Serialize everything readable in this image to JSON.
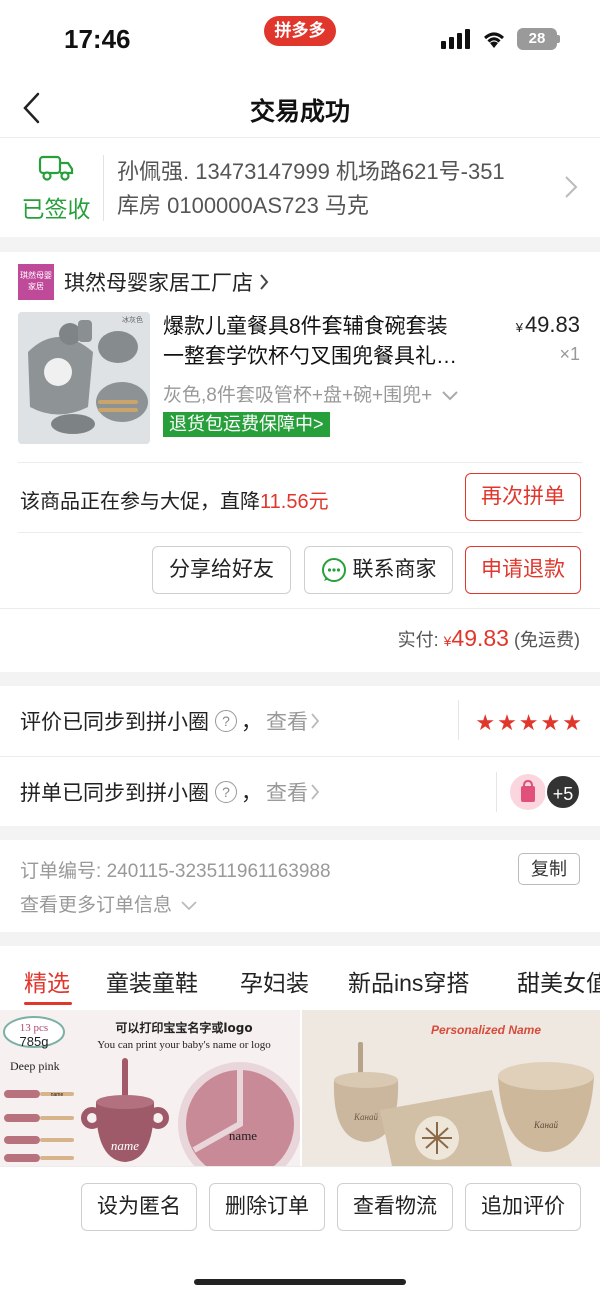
{
  "status_bar": {
    "time": "17:46",
    "app_pill": "拼多多",
    "battery": "28"
  },
  "navbar": {
    "title": "交易成功"
  },
  "address": {
    "status": "已签收",
    "line1": "孙佩强. 13473147999 机场路621号-351",
    "line2": "库房 0100000AS723 马克"
  },
  "store": {
    "logo_text": "琪然母婴家居",
    "name": "琪然母婴家居工厂店"
  },
  "product": {
    "title_line1": "爆款儿童餐具8件套辅食碗套装",
    "title_line2": "一整套学饮杯勺叉围兜餐具礼…",
    "image_tag": "冰灰色",
    "price_symbol": "¥",
    "price": "49.83",
    "quantity": "×1",
    "spec": "灰色,8件套吸管杯+盘+碗+围兜+",
    "badge": "退货包运费保障中>"
  },
  "promo": {
    "text": "该商品正在参与大促，直降",
    "amount": "11.56元",
    "button": "再次拼单"
  },
  "actions": {
    "share": "分享给好友",
    "contact": "联系商家",
    "refund": "申请退款"
  },
  "payment": {
    "label": "实付:",
    "symbol": "¥",
    "amount": "49.83",
    "note": "(免运费)"
  },
  "sync": {
    "review_text": "评价已同步到拼小圈",
    "group_text": "拼单已同步到拼小圈",
    "qmark": "?",
    "comma": "，",
    "view": "查看",
    "stars": [
      "★",
      "★",
      "★",
      "★",
      "★"
    ],
    "plus_count": "+5"
  },
  "order_info": {
    "number_label": "订单编号:",
    "number": "240115-323511961163988",
    "copy": "复制",
    "more": "查看更多订单信息"
  },
  "tabs": [
    "精选",
    "童装童鞋",
    "孕妇装",
    "新品ins穿搭",
    "甜美女值"
  ],
  "recommend": {
    "left": {
      "pcs": "13 pcs",
      "weight": "785g",
      "color_name": "Deep pink",
      "line1": "可以打印宝宝名字或logo",
      "line2": "You can print your baby's name or logo",
      "cup_label": "name",
      "plate_label": "name",
      "spoon_label": "name"
    },
    "right": {
      "headline": "Personalized Name",
      "cup_label": "Канай",
      "bowl_label": "Канай"
    }
  },
  "bottom_buttons": {
    "anonymous": "设为匿名",
    "delete": "删除订单",
    "logistics": "查看物流",
    "add_review": "追加评价"
  },
  "colors": {
    "accent_red": "#e0362c",
    "green": "#27a03b"
  }
}
